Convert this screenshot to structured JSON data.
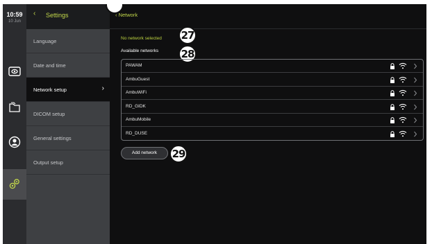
{
  "status": {
    "time": "10:59",
    "date": "10 Jun"
  },
  "rail": {
    "icons": [
      "image-icon",
      "folder-icon",
      "user-icon",
      "gear-icon"
    ],
    "active": "gear-icon"
  },
  "menu": {
    "title": "Settings",
    "items": [
      {
        "label": "Language"
      },
      {
        "label": "Date and time"
      },
      {
        "label": "Network setup",
        "active": true
      },
      {
        "label": "DICOM setup"
      },
      {
        "label": "General settings"
      },
      {
        "label": "Output setup"
      }
    ]
  },
  "main": {
    "title": "Network",
    "status_text": "No network selected",
    "available_label": "Available networks",
    "networks": [
      {
        "name": "PAWAM"
      },
      {
        "name": "AmbuGuest"
      },
      {
        "name": "AmbuWiFi"
      },
      {
        "name": "RD_GIDK"
      },
      {
        "name": "AmbuMobile"
      },
      {
        "name": "RD_DUSE"
      }
    ],
    "add_button": "Add network"
  },
  "callouts": [
    "27",
    "28",
    "29"
  ],
  "colors": {
    "accent": "#c2d74a",
    "background": "#0f0f10",
    "menu": "#3e4043",
    "rail": "#2b2c2f"
  }
}
